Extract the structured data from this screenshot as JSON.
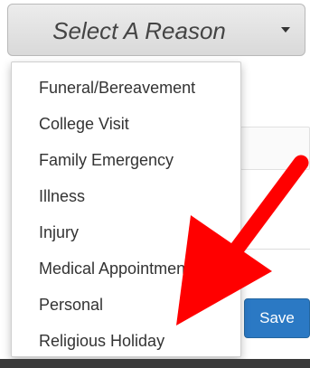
{
  "select": {
    "label": "Select A Reason"
  },
  "menu": {
    "items": [
      "Funeral/Bereavement",
      "College Visit",
      "Family Emergency",
      "Illness",
      "Injury",
      "Medical Appointment",
      "Personal",
      "Religious Holiday"
    ]
  },
  "form": {
    "save_label": "Save"
  },
  "colors": {
    "save_button": "#2b79c4",
    "arrow": "#ff0000"
  }
}
